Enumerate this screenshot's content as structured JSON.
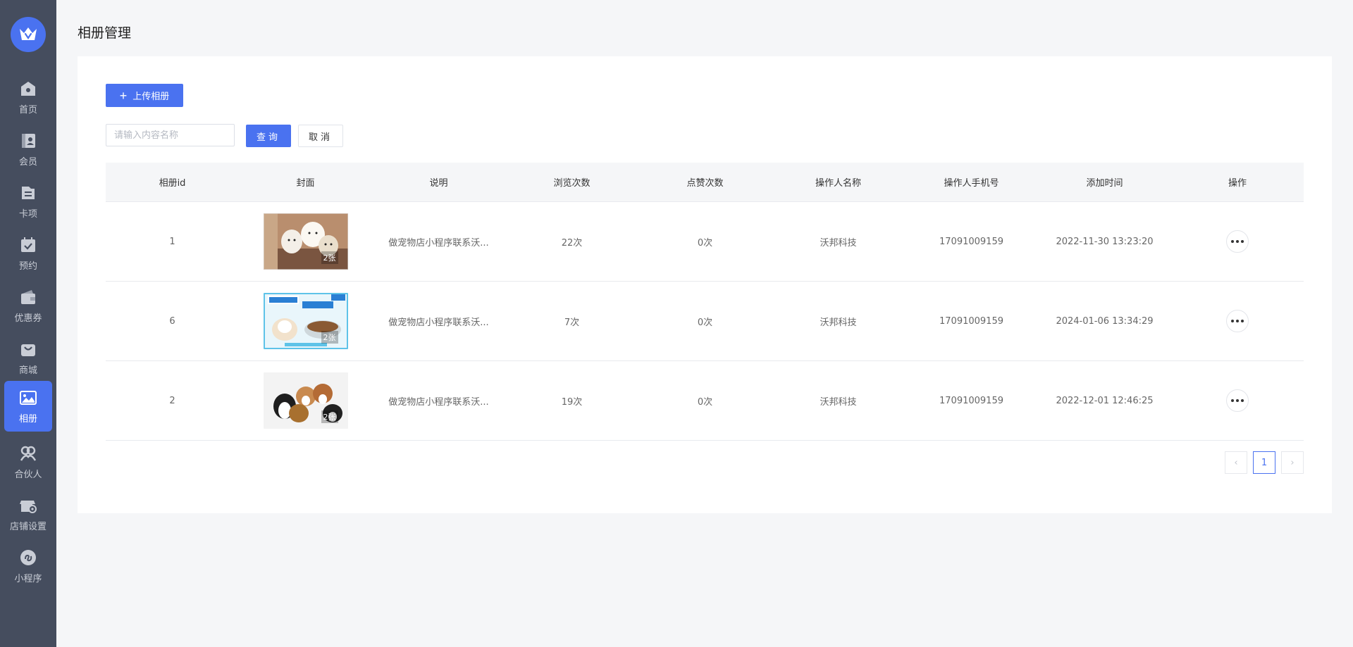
{
  "sidebar": {
    "items": [
      {
        "label": "首页",
        "icon": "home-icon"
      },
      {
        "label": "会员",
        "icon": "member-card-icon"
      },
      {
        "label": "卡项",
        "icon": "card-list-icon"
      },
      {
        "label": "预约",
        "icon": "calendar-check-icon"
      },
      {
        "label": "优惠券",
        "icon": "wallet-icon"
      },
      {
        "label": "商城",
        "icon": "shopping-bag-icon"
      },
      {
        "label": "相册",
        "icon": "image-icon",
        "active": true
      },
      {
        "label": "合伙人",
        "icon": "partner-icon"
      },
      {
        "label": "店铺设置",
        "icon": "store-settings-icon"
      },
      {
        "label": "小程序",
        "icon": "mini-program-icon"
      }
    ]
  },
  "page": {
    "title": "相册管理"
  },
  "toolbar": {
    "upload_label": "上传相册",
    "search_placeholder": "请输入内容名称",
    "query_label": "查询",
    "cancel_label": "取消"
  },
  "table": {
    "headers": [
      "相册id",
      "封面",
      "说明",
      "浏览次数",
      "点赞次数",
      "操作人名称",
      "操作人手机号",
      "添加时间",
      "操作"
    ],
    "rows": [
      {
        "id": "1",
        "cover_count": "2张",
        "desc": "做宠物店小程序联系沃...",
        "views": "22次",
        "likes": "0次",
        "operator": "沃邦科技",
        "phone": "17091009159",
        "time": "2022-11-30 13:23:20"
      },
      {
        "id": "6",
        "cover_count": "2张",
        "desc": "做宠物店小程序联系沃...",
        "views": "7次",
        "likes": "0次",
        "operator": "沃邦科技",
        "phone": "17091009159",
        "time": "2024-01-06 13:34:29"
      },
      {
        "id": "2",
        "cover_count": "2张",
        "desc": "做宠物店小程序联系沃...",
        "views": "19次",
        "likes": "0次",
        "operator": "沃邦科技",
        "phone": "17091009159",
        "time": "2022-12-01 12:46:25"
      }
    ]
  },
  "pagination": {
    "current": "1",
    "prev": "‹",
    "next": "›"
  },
  "colors": {
    "accent": "#4a72f0",
    "sidebar": "#454d5e"
  }
}
